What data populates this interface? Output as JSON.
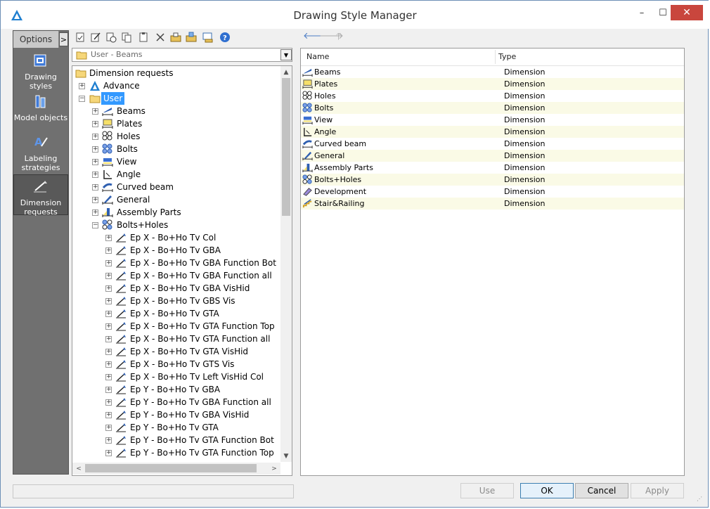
{
  "window": {
    "title": "Drawing Style Manager",
    "min_glyph": "–",
    "max_glyph": "☐",
    "close_glyph": "✕"
  },
  "sidebar": {
    "options_label": "Options",
    "expand_glyph": ">",
    "items": [
      {
        "label": "Drawing styles",
        "icon": "drawing-styles-icon"
      },
      {
        "label": "Model objects",
        "icon": "model-objects-icon"
      },
      {
        "label": "Labeling strategies",
        "icon": "labeling-strategies-icon"
      },
      {
        "label": "Dimension requests",
        "icon": "dimension-requests-icon",
        "active": true
      }
    ]
  },
  "toolbar": {
    "icons": [
      "new-icon",
      "edit-icon",
      "copy-icon",
      "duplicate-icon",
      "paste-icon",
      "delete-icon",
      "import-icon",
      "export-icon",
      "preview-icon",
      "help-icon"
    ],
    "nav_back": "🡐",
    "nav_forward": "🡒",
    "nav_up": "🡑"
  },
  "combo": {
    "value": "User - Beams",
    "arrow": "▼"
  },
  "tree": {
    "root": "Dimension requests",
    "advance": "Advance",
    "user": "User",
    "user_children": [
      "Beams",
      "Plates",
      "Holes",
      "Bolts",
      "View",
      "Angle",
      "Curved beam",
      "General",
      "Assembly Parts",
      "Bolts+Holes"
    ],
    "bolts_holes_children": [
      "Ep X - Bo+Ho Tv Col",
      "Ep X - Bo+Ho Tv GBA",
      "Ep X - Bo+Ho Tv GBA Function Bot",
      "Ep X - Bo+Ho Tv GBA Function all",
      "Ep X - Bo+Ho Tv GBA VisHid",
      "Ep X - Bo+Ho Tv GBS Vis",
      "Ep X - Bo+Ho Tv GTA",
      "Ep X - Bo+Ho Tv GTA Function Top",
      "Ep X - Bo+Ho Tv GTA Function all",
      "Ep X - Bo+Ho Tv GTA VisHid",
      "Ep X - Bo+Ho Tv GTS Vis",
      "Ep X - Bo+Ho Tv Left VisHid Col",
      "Ep Y - Bo+Ho Tv GBA",
      "Ep Y - Bo+Ho Tv GBA Function all",
      "Ep Y - Bo+Ho Tv GBA VisHid",
      "Ep Y - Bo+Ho Tv GTA",
      "Ep Y - Bo+Ho Tv GTA Function Bot",
      "Ep Y - Bo+Ho Tv GTA Function Top"
    ],
    "scroll_up": "▲",
    "scroll_down": "▼",
    "scroll_left": "<",
    "scroll_right": ">"
  },
  "list": {
    "col_name": "Name",
    "col_type": "Type",
    "rows": [
      {
        "name": "Beams",
        "type": "Dimension"
      },
      {
        "name": "Plates",
        "type": "Dimension"
      },
      {
        "name": "Holes",
        "type": "Dimension"
      },
      {
        "name": "Bolts",
        "type": "Dimension"
      },
      {
        "name": "View",
        "type": "Dimension"
      },
      {
        "name": "Angle",
        "type": "Dimension"
      },
      {
        "name": "Curved beam",
        "type": "Dimension"
      },
      {
        "name": "General",
        "type": "Dimension"
      },
      {
        "name": "Assembly Parts",
        "type": "Dimension"
      },
      {
        "name": "Bolts+Holes",
        "type": "Dimension"
      },
      {
        "name": "Development",
        "type": "Dimension"
      },
      {
        "name": "Stair&Railing",
        "type": "Dimension"
      }
    ]
  },
  "buttons": {
    "use": "Use",
    "ok": "OK",
    "cancel": "Cancel",
    "apply": "Apply"
  },
  "colors": {
    "accent": "#3399ff",
    "sidebar": "#707070",
    "alt_row": "#fafae6"
  }
}
